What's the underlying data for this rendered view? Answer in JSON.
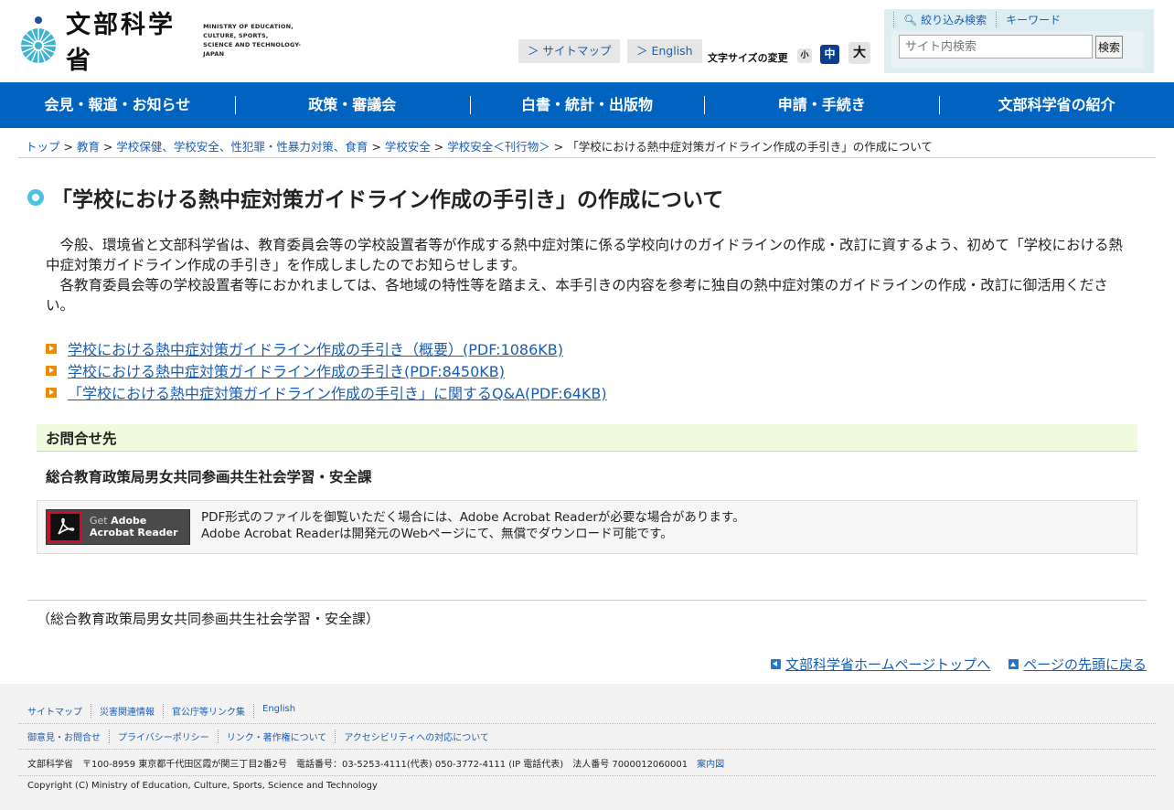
{
  "header": {
    "logo_jp": "文部科学省",
    "logo_en": [
      "MINISTRY OF EDUCATION,",
      "CULTURE, SPORTS,",
      "SCIENCE AND TECHNOLOGY-JAPAN"
    ],
    "sitemap": "＞ サイトマップ",
    "english": "＞ English",
    "font_size_label": "文字サイズの変更",
    "font_small": "小",
    "font_medium": "中",
    "font_large": "大",
    "search_tab_filter": "絞り込み検索",
    "search_tab_keyword": "キーワード",
    "search_placeholder": "サイト内検索",
    "search_button": "検索"
  },
  "nav": [
    "会見・報道・お知らせ",
    "政策・審議会",
    "白書・統計・出版物",
    "申請・手続き",
    "文部科学省の紹介"
  ],
  "breadcrumb": {
    "items": [
      "トップ",
      "教育",
      "学校保健、学校安全、性犯罪・性暴力対策、食育",
      "学校安全",
      "学校安全＜刊行物＞"
    ],
    "current": "「学校における熱中症対策ガイドライン作成の手引き」の作成について"
  },
  "page": {
    "title": "「学校における熱中症対策ガイドライン作成の手引き」の作成について",
    "para1": "　今般、環境省と文部科学省は、教育委員会等の学校設置者等が作成する熱中症対策に係る学校向けのガイドラインの作成・改訂に資するよう、初めて「学校における熱中症対策ガイドライン作成の手引き」を作成しましたのでお知らせします。",
    "para2": "　各教育委員会等の学校設置者等におかれましては、各地域の特性等を踏まえ、本手引きの内容を参考に独自の熱中症対策のガイドラインの作成・改訂に御活用ください。",
    "links": [
      "学校における熱中症対策ガイドライン作成の手引き（概要）(PDF:1086KB)",
      "学校における熱中症対策ガイドライン作成の手引き(PDF:8450KB)",
      "「学校における熱中症対策ガイドライン作成の手引き」に関するQ&A(PDF:64KB)"
    ],
    "contact_heading": "お問合せ先",
    "contact_name": "総合教育政策局男女共同参画共生社会学習・安全課",
    "adobe_get": "Get ",
    "adobe_brand": "Adobe",
    "adobe_product": "Acrobat Reader",
    "adobe_desc1": "PDF形式のファイルを御覧いただく場合には、Adobe Acrobat Readerが必要な場合があります。",
    "adobe_desc2": "Adobe Acrobat Readerは開発元のWebページにて、無償でダウンロード可能です。",
    "dept_footer": "（総合教育政策局男女共同参画共生社会学習・安全課）",
    "home_link": "文部科学省ホームページトップへ",
    "top_link": "ページの先頭に戻る"
  },
  "footer": {
    "row1": [
      "サイトマップ",
      "災害関連情報",
      "官公庁等リンク集",
      "English"
    ],
    "row2": [
      "御意見・お問合せ",
      "プライバシーポリシー",
      "リンク・著作権について",
      "アクセシビリティへの対応について"
    ],
    "address": "文部科学省　〒100-8959 東京都千代田区霞が関三丁目2番2号　電話番号：03-5253-4111(代表) 050-3772-4111 (IP 電話代表)　法人番号 7000012060001",
    "map_link": "案内図",
    "copyright": "Copyright (C) Ministry of Education, Culture, Sports, Science and Technology"
  },
  "colors": {
    "nav_bg": "#0063c0",
    "link": "#1a5db0",
    "title_mark": "#4ec3e0",
    "contact_bg": "#f0fadc",
    "pdf_icon": "#f08a00"
  }
}
